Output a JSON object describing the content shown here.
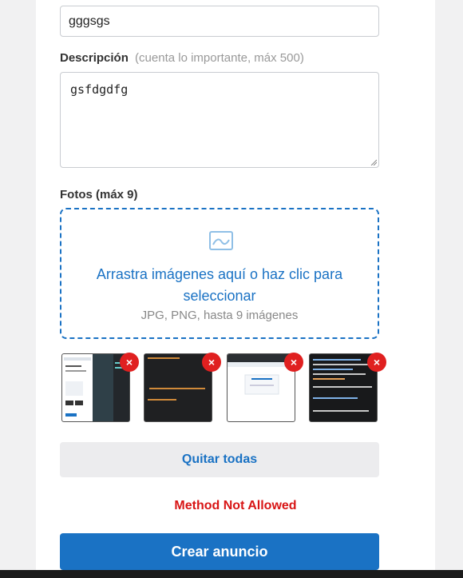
{
  "form": {
    "title_value": "gggsgs",
    "description_label": "Descripción",
    "description_hint": "(cuenta lo importante, máx 500)",
    "description_value": "gsfdgdfg",
    "photos_label": "Fotos (máx 9)",
    "dropzone_title": "Arrastra imágenes aquí o haz clic para seleccionar",
    "dropzone_subtitle": "JPG, PNG, hasta 9 imágenes",
    "remove_glyph": "×",
    "thumbnails": [
      {
        "name": "screenshot-1",
        "snippet": ""
      },
      {
        "name": "screenshot-2",
        "snippet": "'error');\n\n al conectar c\nerror');"
      },
      {
        "name": "screenshot-3",
        "snippet": ""
      },
      {
        "name": "screenshot-4",
        "snippet": ""
      }
    ],
    "clear_all_label": "Quitar todas",
    "error_message": "Method Not Allowed",
    "submit_label": "Crear anuncio"
  },
  "colors": {
    "accent": "#1a72c4",
    "error": "#d81515",
    "remove": "#e02020"
  }
}
